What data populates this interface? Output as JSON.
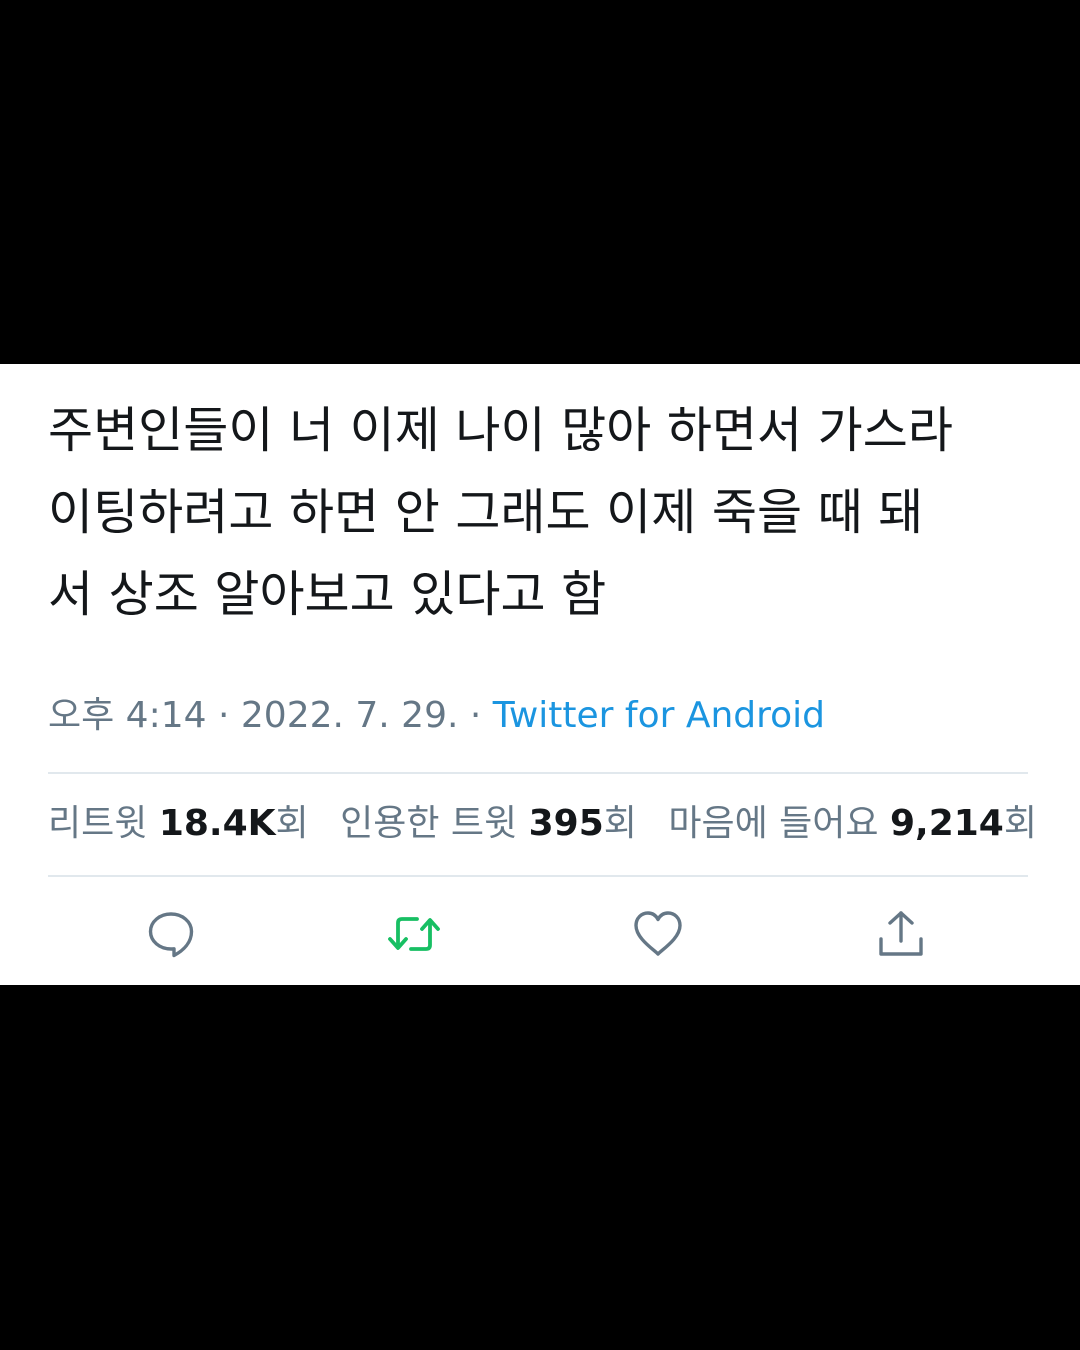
{
  "tweet": {
    "text": "주변인들이 너 이제 나이 많아 하면서 가스라\n이팅하려고 하면 안 그래도 이제 죽을 때 돼\n서 상조 알아보고 있다고 함",
    "time": "오후 4:14",
    "separator": "·",
    "date": "2022. 7. 29.",
    "source": "Twitter for Android"
  },
  "stats": {
    "retweets": {
      "label": "리트윗",
      "value": "18.4K",
      "suffix": "회"
    },
    "quotes": {
      "label": "인용한 트윗",
      "value": "395",
      "suffix": "회"
    },
    "likes": {
      "label": "마음에 들어요",
      "value": "9,214",
      "suffix": "회"
    }
  },
  "actions": {
    "reply_icon": "reply-icon",
    "retweet_icon": "retweet-icon",
    "like_icon": "heart-icon",
    "share_icon": "share-icon"
  },
  "colors": {
    "text": "#14171a",
    "secondary": "#657786",
    "link": "#1b95e0",
    "retweet_active": "#17bf63",
    "divider": "#e1e8ed",
    "background_frame": "#000000",
    "card": "#ffffff"
  }
}
